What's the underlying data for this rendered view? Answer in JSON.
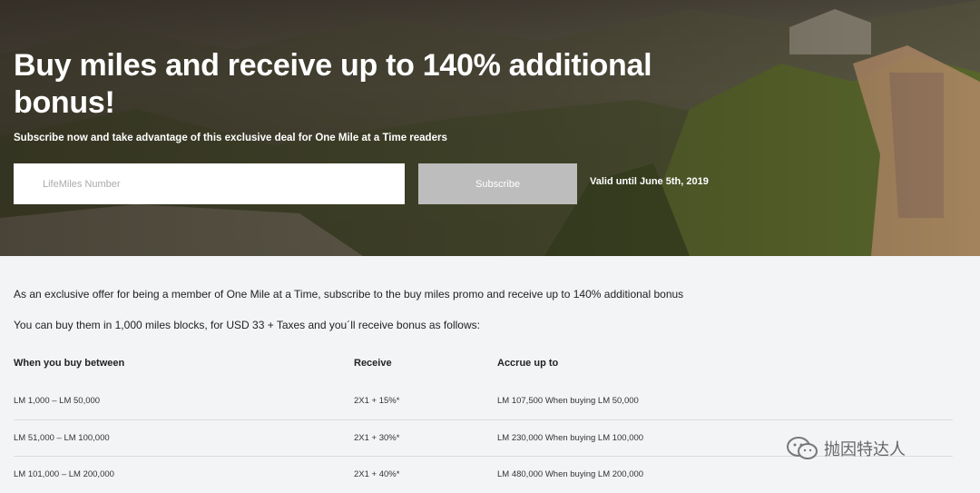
{
  "hero": {
    "headline": "Buy miles and receive up to 140% additional bonus!",
    "subheadline": "Subscribe now and take advantage of this exclusive deal for One Mile at a Time readers",
    "input_placeholder": "LifeMiles Number",
    "subscribe_label": "Subscribe",
    "valid_text": "Valid until June 5th, 2019"
  },
  "body": {
    "intro": "As an exclusive offer for being a member of One Mile at a Time, subscribe to the buy miles promo and receive up to 140% additional bonus",
    "blocks": "You can buy them in 1,000 miles blocks, for USD 33 + Taxes and you´ll receive bonus as follows:"
  },
  "table": {
    "headers": [
      "When you buy between",
      "Receive",
      "Accrue up to"
    ],
    "rows": [
      [
        "LM 1,000 – LM 50,000",
        "2X1 + 15%*",
        "LM 107,500 When buying LM 50,000"
      ],
      [
        "LM 51,000 – LM 100,000",
        "2X1 + 30%*",
        "LM 230,000 When buying LM 100,000"
      ],
      [
        "LM 101,000 – LM 200,000",
        "2X1 + 40%*",
        "LM 480,000 When buying LM 200,000"
      ]
    ]
  },
  "watermark": {
    "text": "抛因特达人",
    "icon": "wechat-icon"
  }
}
